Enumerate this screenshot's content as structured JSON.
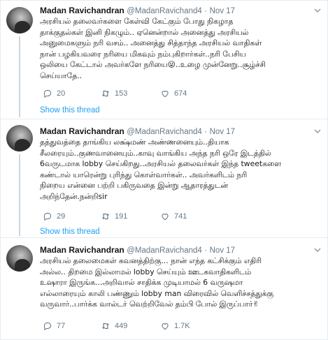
{
  "tweets": [
    {
      "name": "Madan Ravichandran",
      "handle": "@MadanRavichand4",
      "dot": "·",
      "date": "Nov 17",
      "text": "அரசியல் தலைவர்களை கேள்வி கேட்கும் போது நிகழாத\nதாக்குதல்கள் இனி நிகழும்.. ஏனென்றால் அனைத்து அரசியல்\nஅனுமைகளும் நரி வசம்.. அனைத்து சித்தாந்த அரசியல் வாதிகள்\nநான் பழகியவரை நரியை மிகவும் நம்புகிறார்கள்..நரி பேசிய\nஒலியை கேட்டால் அவர்களே நரியை😜..உழை முன்னேறு..சூழ்ச்சி\nசெய்யாதே..",
      "replies": "20",
      "retweets": "153",
      "likes": "674",
      "show_thread": "Show this thread"
    },
    {
      "name": "Madan Ravichandran",
      "handle": "@MadanRavichand4",
      "dot": "·",
      "date": "Nov 17",
      "text": "தத்துவத்தை தாங்கிய லக்ஷ்மண் அண்ணனையும்..தியாக\nசீலரையும்..குணவானையும்..காவு வாங்கிய அந்த நரி ஒரே இடத்தில்\n6வருடமாக lobby செய்கிறது..அரசியல் தலைவர்கள் இந்த tweetகளை\nகண்டால் யாரென்று புரிந்து கொள்வார்கள்.. அவர்களிடம் நரி\nநிறைய என்னை பற்றி பகிருவதை இன்று ஆதாரத்துடன்\nஅறிந்தேன்.நன்றிsir",
      "replies": "29",
      "retweets": "191",
      "likes": "741",
      "show_thread": "Show this thread"
    },
    {
      "name": "Madan Ravichandran",
      "handle": "@MadanRavichand4",
      "dot": "·",
      "date": "Nov 17",
      "text": "அரசியல் தலைமைகள் கவனத்திற்கு... நான் எந்த கட்சிக்கும் எதிரி\nஅல்ல.. திறமை இல்லாமல் lobby செய்யும் ஊடகவாதிகளிடம்\nஉஷாரா இருங்க...அறிவால் சாதிக்க முடியாமல் 6 வருஷமா\nஎல்லாரையும் காலி பண்ணும் lobby man விரைவில் வெளிச்சத்துக்கு\nவருவார்..பார்க்க வால்டர் வெற்றிவேல் தம்பி போல் இருப்பார்✌",
      "replies": "77",
      "retweets": "449",
      "likes": "1.7K",
      "show_thread": ""
    }
  ],
  "icons": {
    "chevron": "chevron-down-icon",
    "reply": "reply-icon",
    "retweet": "retweet-icon",
    "like": "heart-icon"
  },
  "colors": {
    "link": "#1da1f2",
    "muted": "#657786",
    "text": "#14171a",
    "border": "#e6ecf0"
  }
}
